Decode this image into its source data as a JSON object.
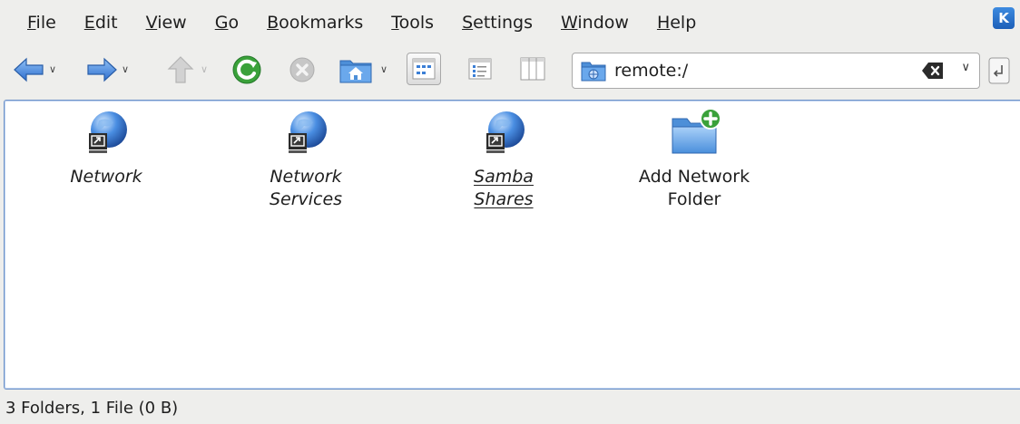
{
  "menubar": {
    "items": [
      {
        "label": "File",
        "mnemonic": "F",
        "rest": "ile"
      },
      {
        "label": "Edit",
        "mnemonic": "E",
        "rest": "dit"
      },
      {
        "label": "View",
        "mnemonic": "V",
        "rest": "iew"
      },
      {
        "label": "Go",
        "mnemonic": "G",
        "rest": "o"
      },
      {
        "label": "Bookmarks",
        "mnemonic": "B",
        "rest": "ookmarks"
      },
      {
        "label": "Tools",
        "mnemonic": "T",
        "rest": "ools"
      },
      {
        "label": "Settings",
        "mnemonic": "S",
        "rest": "ettings"
      },
      {
        "label": "Window",
        "mnemonic": "W",
        "rest": "indow"
      },
      {
        "label": "Help",
        "mnemonic": "H",
        "rest": "elp"
      }
    ]
  },
  "toolbar": {
    "icons": {
      "back": "back-arrow-icon",
      "forward": "forward-arrow-icon",
      "up": "up-arrow-icon",
      "reload": "reload-icon",
      "stop": "stop-icon",
      "home": "home-folder-icon",
      "icons_view": "icons-view-icon",
      "details_view": "details-view-icon",
      "columns_view": "columns-view-icon"
    },
    "colors": {
      "arrow_blue": "#3a7bd5",
      "reload_green": "#3aa13a",
      "disabled_gray": "#bdbdbd"
    }
  },
  "location": {
    "value": "remote:/"
  },
  "content": {
    "items": [
      {
        "label": "Network",
        "icon": "network-globe-icon",
        "link": true
      },
      {
        "label": "Network\nServices",
        "icon": "network-globe-icon",
        "link": true
      },
      {
        "label": "Samba\nShares",
        "icon": "network-globe-icon",
        "link": true
      },
      {
        "label": "Add Network\nFolder",
        "icon": "add-folder-icon",
        "link": false
      }
    ],
    "border_color": "#6f93c9"
  },
  "status": {
    "text": "3 Folders, 1 File (0 B)"
  }
}
